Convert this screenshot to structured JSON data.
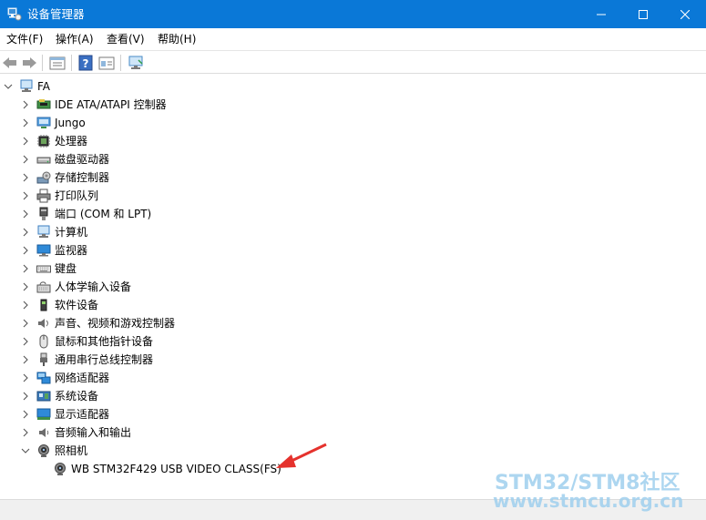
{
  "window": {
    "title": "设备管理器",
    "buttons": {
      "minimize": "–",
      "maximize": "☐",
      "close": "✕"
    }
  },
  "menu": [
    "文件(F)",
    "操作(A)",
    "查看(V)",
    "帮助(H)"
  ],
  "toolbar": [
    "back-icon",
    "forward-icon",
    "properties-icon",
    "help-icon",
    "view-icon",
    "computer-monitor-icon"
  ],
  "tree": {
    "root": {
      "label": "FA",
      "icon": "computer-icon"
    },
    "categories": [
      {
        "label": "IDE ATA/ATAPI 控制器",
        "icon": "ide-controller-icon"
      },
      {
        "label": "Jungo",
        "icon": "jungo-icon"
      },
      {
        "label": "处理器",
        "icon": "processor-icon"
      },
      {
        "label": "磁盘驱动器",
        "icon": "disk-drive-icon"
      },
      {
        "label": "存储控制器",
        "icon": "storage-controller-icon"
      },
      {
        "label": "打印队列",
        "icon": "printer-icon"
      },
      {
        "label": "端口 (COM 和 LPT)",
        "icon": "port-icon"
      },
      {
        "label": "计算机",
        "icon": "computer-icon"
      },
      {
        "label": "监视器",
        "icon": "monitor-icon"
      },
      {
        "label": "键盘",
        "icon": "keyboard-icon"
      },
      {
        "label": "人体学输入设备",
        "icon": "hid-icon"
      },
      {
        "label": "软件设备",
        "icon": "software-device-icon"
      },
      {
        "label": "声音、视频和游戏控制器",
        "icon": "speaker-icon"
      },
      {
        "label": "鼠标和其他指针设备",
        "icon": "mouse-icon"
      },
      {
        "label": "通用串行总线控制器",
        "icon": "usb-icon"
      },
      {
        "label": "网络适配器",
        "icon": "network-adapter-icon"
      },
      {
        "label": "系统设备",
        "icon": "system-device-icon"
      },
      {
        "label": "显示适配器",
        "icon": "display-adapter-icon"
      },
      {
        "label": "音频输入和输出",
        "icon": "audio-io-icon"
      },
      {
        "label": "照相机",
        "icon": "camera-icon",
        "expanded": true
      }
    ],
    "camera_child": {
      "label": "WB STM32F429 USB VIDEO CLASS(FS)",
      "icon": "webcam-icon"
    }
  },
  "watermark": {
    "line1": "STM32/STM8社区",
    "line2": "www.stmcu.org.cn"
  },
  "colors": {
    "titlebar": "#0a78d7",
    "arrow": "#e5322d",
    "watermark": "#9fd0ee"
  }
}
